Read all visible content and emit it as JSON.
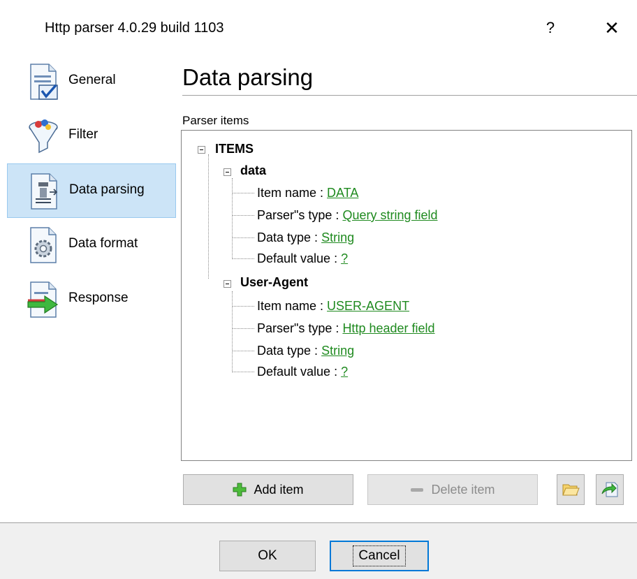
{
  "window": {
    "title": "Http parser 4.0.29 build 1103",
    "help_label": "?",
    "close_label": "✕"
  },
  "sidebar": {
    "items": [
      {
        "label": "General",
        "icon": "document-check-icon"
      },
      {
        "label": "Filter",
        "icon": "funnel-icon"
      },
      {
        "label": "Data parsing",
        "icon": "parsing-icon",
        "active": true
      },
      {
        "label": "Data format",
        "icon": "gear-document-icon"
      },
      {
        "label": "Response",
        "icon": "arrow-document-icon"
      }
    ]
  },
  "main": {
    "title": "Data parsing",
    "section_label": "Parser items",
    "tree": {
      "root": "ITEMS",
      "groups": [
        {
          "name": "data",
          "fields": [
            {
              "label": "Item name : ",
              "value": "DATA"
            },
            {
              "label": "Parser\"s type : ",
              "value": "Query string field"
            },
            {
              "label": "Data type : ",
              "value": "String"
            },
            {
              "label": "Default value : ",
              "value": "?"
            }
          ]
        },
        {
          "name": "User-Agent",
          "fields": [
            {
              "label": "Item name : ",
              "value": "USER-AGENT"
            },
            {
              "label": "Parser\"s type : ",
              "value": "Http header field"
            },
            {
              "label": "Data type : ",
              "value": "String"
            },
            {
              "label": "Default value : ",
              "value": "?"
            }
          ]
        }
      ]
    },
    "buttons": {
      "add_label": "Add item",
      "delete_label": "Delete item"
    }
  },
  "footer": {
    "ok_label": "OK",
    "cancel_label": "Cancel"
  },
  "colors": {
    "link_green": "#1f8a1f",
    "active_bg": "#cce4f7",
    "accent": "#0078d7"
  }
}
